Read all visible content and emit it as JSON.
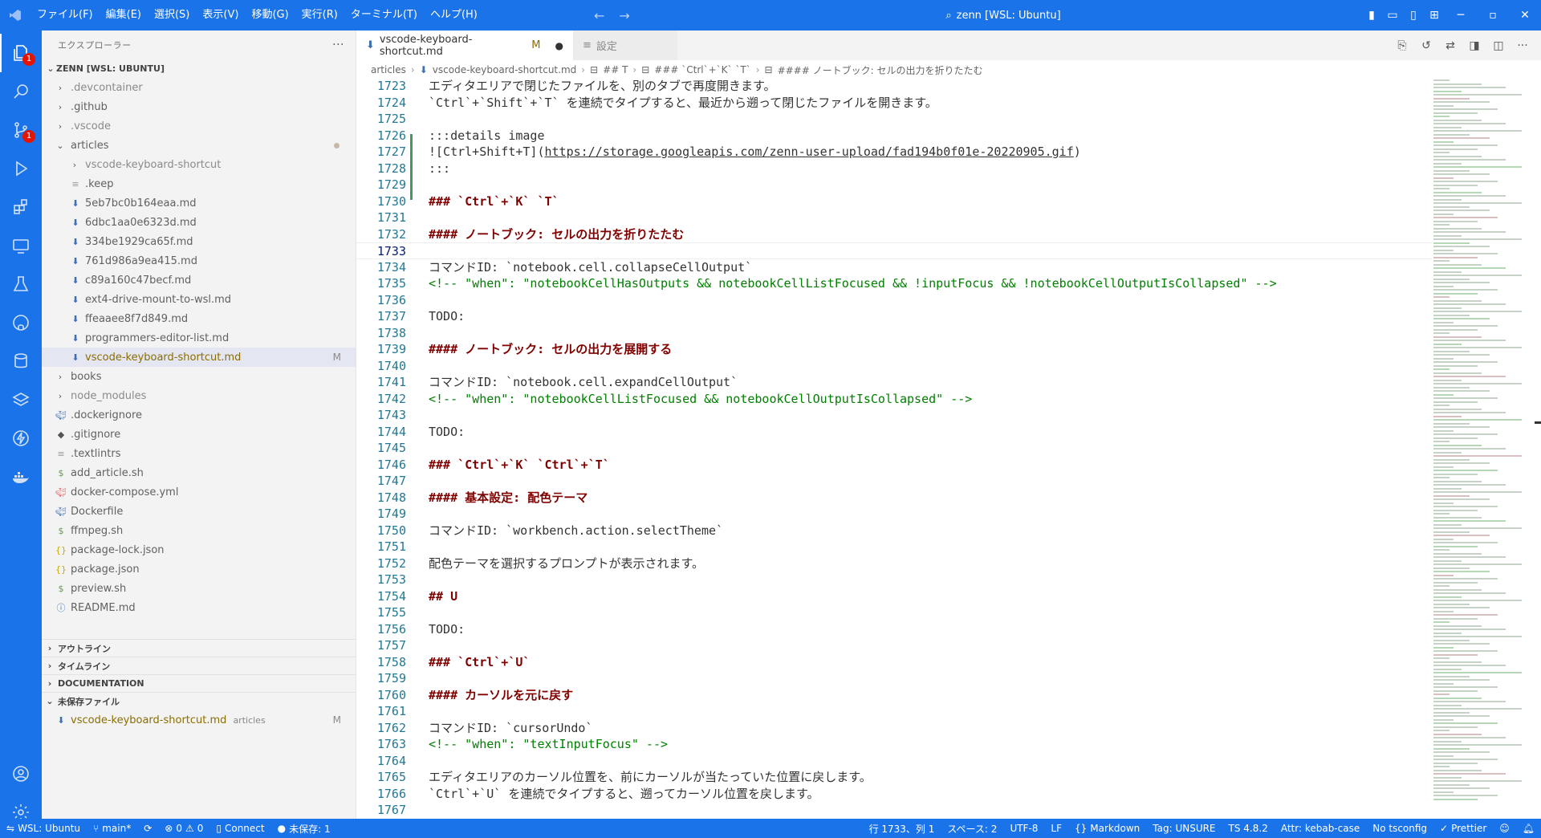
{
  "titlebar": {
    "menus": [
      "ファイル(F)",
      "編集(E)",
      "選択(S)",
      "表示(V)",
      "移動(G)",
      "実行(R)",
      "ターミナル(T)",
      "ヘルプ(H)"
    ],
    "search_text": "zenn [WSL: Ubuntu]"
  },
  "activity": {
    "explorer_badge": "1",
    "scm_badge": "1"
  },
  "sidebar": {
    "header": "エクスプローラー",
    "root": "ZENN [WSL: UBUNTU]",
    "items": [
      {
        "label": ".devcontainer",
        "kind": "folder",
        "dim": true
      },
      {
        "label": ".github",
        "kind": "folder"
      },
      {
        "label": ".vscode",
        "kind": "folder",
        "dim": true
      },
      {
        "label": "articles",
        "kind": "folder-open"
      },
      {
        "label": "vscode-keyboard-shortcut",
        "kind": "folder",
        "dim": true
      },
      {
        "label": ".keep",
        "kind": "file"
      },
      {
        "label": "5eb7bc0b164eaa.md",
        "kind": "md"
      },
      {
        "label": "6dbc1aa0e6323d.md",
        "kind": "md"
      },
      {
        "label": "334be1929ca65f.md",
        "kind": "md"
      },
      {
        "label": "761d986a9ea415.md",
        "kind": "md"
      },
      {
        "label": "c89a160c47becf.md",
        "kind": "md"
      },
      {
        "label": "ext4-drive-mount-to-wsl.md",
        "kind": "md"
      },
      {
        "label": "ffeaaee8f7d849.md",
        "kind": "md"
      },
      {
        "label": "programmers-editor-list.md",
        "kind": "md"
      },
      {
        "label": "vscode-keyboard-shortcut.md",
        "kind": "md",
        "status": "M"
      },
      {
        "label": "books",
        "kind": "folder"
      },
      {
        "label": "node_modules",
        "kind": "folder",
        "dim": true
      },
      {
        "label": ".dockerignore",
        "kind": "docker"
      },
      {
        "label": ".gitignore",
        "kind": "git"
      },
      {
        "label": ".textlintrs",
        "kind": "file"
      },
      {
        "label": "add_article.sh",
        "kind": "sh"
      },
      {
        "label": "docker-compose.yml",
        "kind": "docker"
      },
      {
        "label": "Dockerfile",
        "kind": "docker"
      },
      {
        "label": "ffmpeg.sh",
        "kind": "sh"
      },
      {
        "label": "package-lock.json",
        "kind": "json"
      },
      {
        "label": "package.json",
        "kind": "json"
      },
      {
        "label": "preview.sh",
        "kind": "sh"
      },
      {
        "label": "README.md",
        "kind": "info"
      }
    ],
    "sections": [
      "アウトライン",
      "タイムライン",
      "DOCUMENTATION",
      "未保存ファイル"
    ],
    "unsaved_file": "vscode-keyboard-shortcut.md",
    "unsaved_folder": "articles",
    "unsaved_status": "M"
  },
  "tabs": [
    {
      "label": "vscode-keyboard-shortcut.md",
      "modified": "M",
      "dirty": "●"
    },
    {
      "label": "設定"
    }
  ],
  "breadcrumb": [
    "articles",
    "vscode-keyboard-shortcut.md",
    "## T",
    "### `Ctrl`+`K` `T`",
    "#### ノートブック: セルの出力を折りたたむ"
  ],
  "editor": {
    "lines": [
      {
        "n": "1723",
        "t": "エディタエリアで閉じたファイルを、別のタブで再度開きます。",
        "k": "plain"
      },
      {
        "n": "1724",
        "t": "`Ctrl`+`Shift`+`T` を連続でタイプすると、最近から遡って閉じたファイルを開きます。",
        "k": "plain"
      },
      {
        "n": "1725",
        "t": "",
        "k": "plain"
      },
      {
        "n": "1726",
        "t": ":::details image",
        "k": "plain"
      },
      {
        "n": "1727",
        "t": "![Ctrl+Shift+T](",
        "k": "plain",
        "link": "https://storage.googleapis.com/zenn-user-upload/fad194b0f01e-20220905.gif",
        "after": ")"
      },
      {
        "n": "1728",
        "t": ":::",
        "k": "plain"
      },
      {
        "n": "1729",
        "t": "",
        "k": "plain"
      },
      {
        "n": "1730",
        "t": "### `Ctrl`+`K` `T`",
        "k": "heading"
      },
      {
        "n": "1731",
        "t": "",
        "k": "plain"
      },
      {
        "n": "1732",
        "t": "#### ノートブック: セルの出力を折りたたむ",
        "k": "heading"
      },
      {
        "n": "1733",
        "t": "",
        "k": "plain",
        "current": true
      },
      {
        "n": "1734",
        "t": "コマンドID: `notebook.cell.collapseCellOutput`",
        "k": "plain"
      },
      {
        "n": "1735",
        "t": "<!-- \"when\": \"notebookCellHasOutputs && notebookCellListFocused && !inputFocus && !notebookCellOutputIsCollapsed\" -->",
        "k": "comment"
      },
      {
        "n": "1736",
        "t": "",
        "k": "plain"
      },
      {
        "n": "1737",
        "t": "TODO:",
        "k": "plain"
      },
      {
        "n": "1738",
        "t": "",
        "k": "plain"
      },
      {
        "n": "1739",
        "t": "#### ノートブック: セルの出力を展開する",
        "k": "heading"
      },
      {
        "n": "1740",
        "t": "",
        "k": "plain"
      },
      {
        "n": "1741",
        "t": "コマンドID: `notebook.cell.expandCellOutput`",
        "k": "plain"
      },
      {
        "n": "1742",
        "t": "<!-- \"when\": \"notebookCellListFocused && notebookCellOutputIsCollapsed\" -->",
        "k": "comment"
      },
      {
        "n": "1743",
        "t": "",
        "k": "plain"
      },
      {
        "n": "1744",
        "t": "TODO:",
        "k": "plain"
      },
      {
        "n": "1745",
        "t": "",
        "k": "plain"
      },
      {
        "n": "1746",
        "t": "### `Ctrl`+`K` `Ctrl`+`T`",
        "k": "heading"
      },
      {
        "n": "1747",
        "t": "",
        "k": "plain"
      },
      {
        "n": "1748",
        "t": "#### 基本設定: 配色テーマ",
        "k": "heading"
      },
      {
        "n": "1749",
        "t": "",
        "k": "plain"
      },
      {
        "n": "1750",
        "t": "コマンドID: `workbench.action.selectTheme`",
        "k": "plain"
      },
      {
        "n": "1751",
        "t": "",
        "k": "plain"
      },
      {
        "n": "1752",
        "t": "配色テーマを選択するプロンプトが表示されます。",
        "k": "plain"
      },
      {
        "n": "1753",
        "t": "",
        "k": "plain"
      },
      {
        "n": "1754",
        "t": "## U",
        "k": "heading"
      },
      {
        "n": "1755",
        "t": "",
        "k": "plain"
      },
      {
        "n": "1756",
        "t": "TODO:",
        "k": "plain"
      },
      {
        "n": "1757",
        "t": "",
        "k": "plain"
      },
      {
        "n": "1758",
        "t": "### `Ctrl`+`U`",
        "k": "heading"
      },
      {
        "n": "1759",
        "t": "",
        "k": "plain"
      },
      {
        "n": "1760",
        "t": "#### カーソルを元に戻す",
        "k": "heading"
      },
      {
        "n": "1761",
        "t": "",
        "k": "plain"
      },
      {
        "n": "1762",
        "t": "コマンドID: `cursorUndo`",
        "k": "plain"
      },
      {
        "n": "1763",
        "t": "<!-- \"when\": \"textInputFocus\" -->",
        "k": "comment"
      },
      {
        "n": "1764",
        "t": "",
        "k": "plain"
      },
      {
        "n": "1765",
        "t": "エディタエリアのカーソル位置を、前にカーソルが当たっていた位置に戻します。",
        "k": "plain"
      },
      {
        "n": "1766",
        "t": "`Ctrl`+`U` を連続でタイプすると、遡ってカーソル位置を戻します。",
        "k": "plain"
      },
      {
        "n": "1767",
        "t": "",
        "k": "plain"
      }
    ]
  },
  "statusbar": {
    "remote": "WSL: Ubuntu",
    "branch": "main*",
    "errors": "0",
    "warnings": "0",
    "connect": "Connect",
    "unsaved": "未保存: 1",
    "position": "行 1733、列 1",
    "spaces": "スペース: 2",
    "encoding": "UTF-8",
    "eol": "LF",
    "language": "Markdown",
    "tag": "Tag: UNSURE",
    "ts": "TS 4.8.2",
    "attr": "Attr: kebab-case",
    "tsconfig": "No tsconfig",
    "prettier": "Prettier"
  },
  "colors": {
    "accent": "#1a73e8",
    "heading": "#800000",
    "comment": "#008000",
    "line_number": "#237893"
  }
}
